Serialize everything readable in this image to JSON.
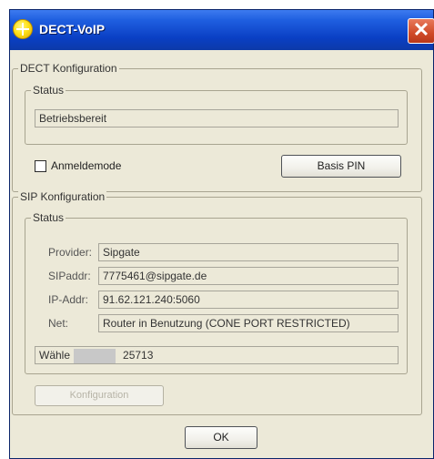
{
  "window": {
    "title": "DECT-VoIP",
    "close_symbol": "✕"
  },
  "dect": {
    "legend": "DECT Konfiguration",
    "status_legend": "Status",
    "status_value": "Betriebsbereit",
    "checkbox_label": "Anmeldemode",
    "basis_pin_label": "Basis PIN"
  },
  "sip": {
    "legend": "SIP Konfiguration",
    "status_legend": "Status",
    "rows": [
      {
        "label": "Provider:",
        "value": "Sipgate"
      },
      {
        "label": "SIPaddr:",
        "value": "7775461@sipgate.de"
      },
      {
        "label": "IP-Addr:",
        "value": "91.62.121.240:5060"
      },
      {
        "label": "Net:",
        "value": "Router in Benutzung (CONE PORT RESTRICTED)"
      }
    ],
    "dial_prefix": "Wähle",
    "dial_suffix": "25713",
    "config_button": "Konfiguration"
  },
  "ok_button": "OK"
}
